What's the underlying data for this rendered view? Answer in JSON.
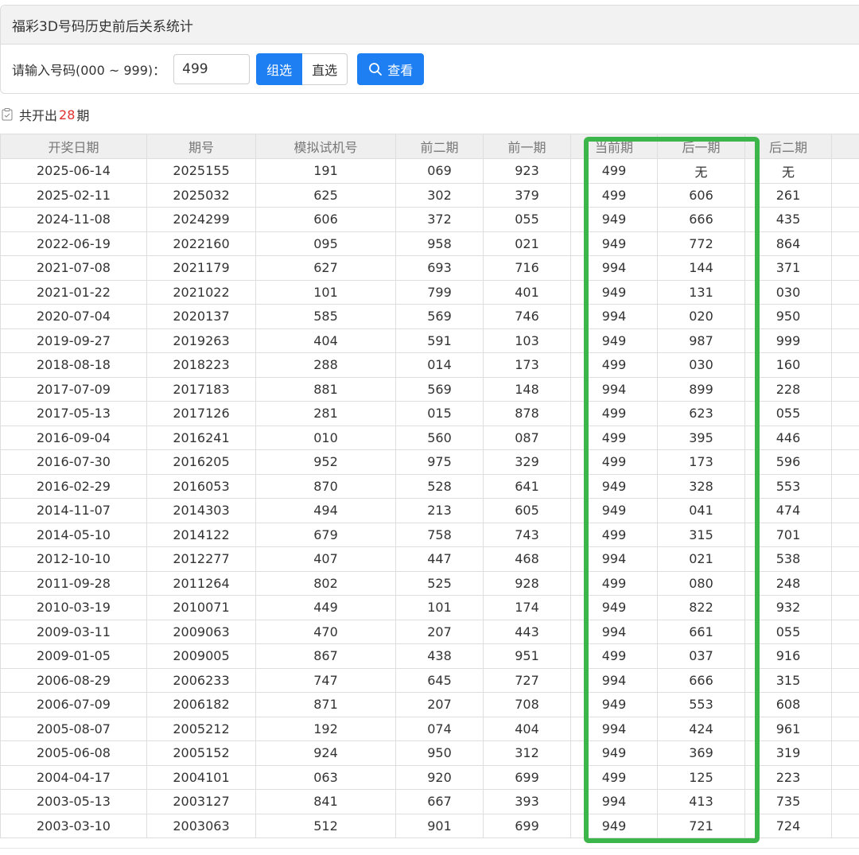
{
  "panel": {
    "title": "福彩3D号码历史前后关系统计"
  },
  "query": {
    "label": "请输入号码(000 ~ 999)：",
    "input_value": "499",
    "mode_options": [
      "组选",
      "直选"
    ],
    "mode_selected": "组选",
    "view_label": "查看"
  },
  "summary": {
    "prefix": "共开出",
    "count": "28",
    "suffix": "期"
  },
  "table": {
    "headers": [
      "开奖日期",
      "期号",
      "模拟试机号",
      "前二期",
      "前一期",
      "当前期",
      "后一期",
      "后二期",
      ""
    ],
    "rows": [
      [
        "2025-06-14",
        "2025155",
        "191",
        "069",
        "923",
        "499",
        "无",
        "无"
      ],
      [
        "2025-02-11",
        "2025032",
        "625",
        "302",
        "379",
        "499",
        "606",
        "261"
      ],
      [
        "2024-11-08",
        "2024299",
        "606",
        "372",
        "055",
        "949",
        "666",
        "435"
      ],
      [
        "2022-06-19",
        "2022160",
        "095",
        "958",
        "021",
        "949",
        "772",
        "864"
      ],
      [
        "2021-07-08",
        "2021179",
        "627",
        "693",
        "716",
        "994",
        "144",
        "371"
      ],
      [
        "2021-01-22",
        "2021022",
        "101",
        "799",
        "401",
        "949",
        "131",
        "030"
      ],
      [
        "2020-07-04",
        "2020137",
        "585",
        "569",
        "746",
        "994",
        "020",
        "950"
      ],
      [
        "2019-09-27",
        "2019263",
        "404",
        "591",
        "103",
        "949",
        "987",
        "999"
      ],
      [
        "2018-08-18",
        "2018223",
        "288",
        "014",
        "173",
        "499",
        "030",
        "160"
      ],
      [
        "2017-07-09",
        "2017183",
        "881",
        "569",
        "148",
        "994",
        "899",
        "228"
      ],
      [
        "2017-05-13",
        "2017126",
        "281",
        "015",
        "878",
        "499",
        "623",
        "055"
      ],
      [
        "2016-09-04",
        "2016241",
        "010",
        "560",
        "087",
        "499",
        "395",
        "446"
      ],
      [
        "2016-07-30",
        "2016205",
        "952",
        "975",
        "329",
        "499",
        "173",
        "596"
      ],
      [
        "2016-02-29",
        "2016053",
        "870",
        "528",
        "641",
        "949",
        "328",
        "553"
      ],
      [
        "2014-11-07",
        "2014303",
        "494",
        "213",
        "605",
        "949",
        "041",
        "474"
      ],
      [
        "2014-05-10",
        "2014122",
        "679",
        "758",
        "743",
        "499",
        "315",
        "701"
      ],
      [
        "2012-10-10",
        "2012277",
        "407",
        "447",
        "468",
        "994",
        "021",
        "538"
      ],
      [
        "2011-09-28",
        "2011264",
        "802",
        "525",
        "928",
        "499",
        "080",
        "248"
      ],
      [
        "2010-03-19",
        "2010071",
        "449",
        "101",
        "174",
        "949",
        "822",
        "932"
      ],
      [
        "2009-03-11",
        "2009063",
        "470",
        "207",
        "443",
        "994",
        "661",
        "055"
      ],
      [
        "2009-01-05",
        "2009005",
        "867",
        "438",
        "951",
        "499",
        "037",
        "916"
      ],
      [
        "2006-08-29",
        "2006233",
        "747",
        "645",
        "727",
        "994",
        "666",
        "315"
      ],
      [
        "2006-07-09",
        "2006182",
        "871",
        "207",
        "708",
        "949",
        "553",
        "608"
      ],
      [
        "2005-08-07",
        "2005212",
        "192",
        "074",
        "404",
        "994",
        "424",
        "961"
      ],
      [
        "2005-06-08",
        "2005152",
        "924",
        "950",
        "312",
        "949",
        "369",
        "319"
      ],
      [
        "2004-04-17",
        "2004101",
        "063",
        "920",
        "699",
        "499",
        "125",
        "223"
      ],
      [
        "2003-05-13",
        "2003127",
        "841",
        "667",
        "393",
        "994",
        "413",
        "735"
      ],
      [
        "2003-03-10",
        "2003063",
        "512",
        "901",
        "699",
        "949",
        "721",
        "724"
      ]
    ]
  },
  "colors": {
    "accent": "#1e7ff2",
    "highlight": "#3cb54a",
    "count": "#e03030"
  }
}
